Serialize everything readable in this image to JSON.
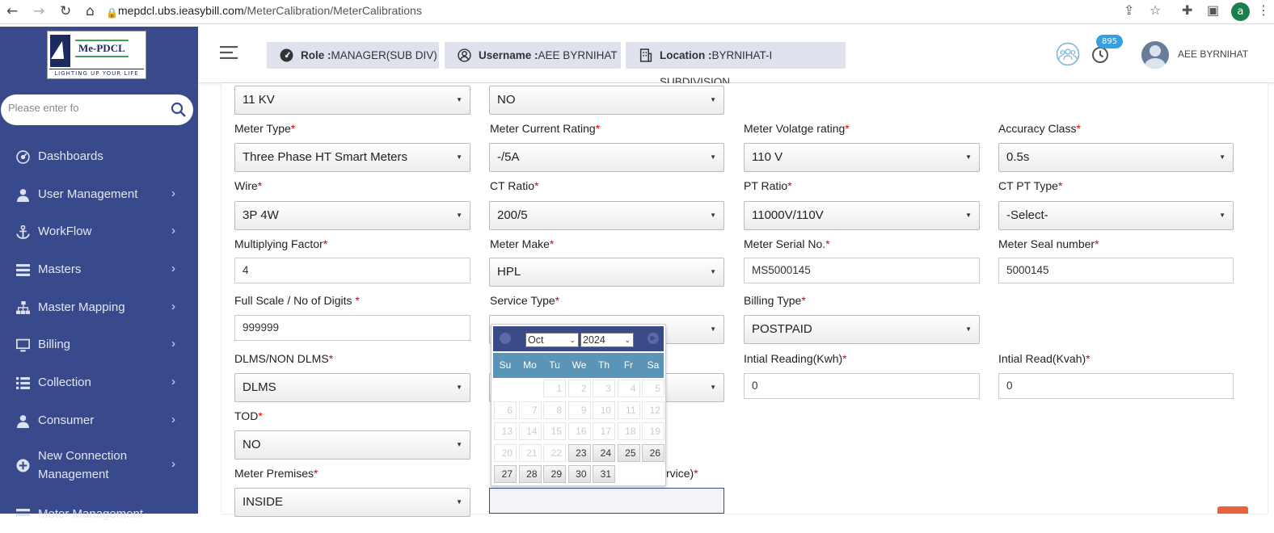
{
  "browser": {
    "url_host": "mepdcl.ubs.ieasybill.com",
    "url_path": "/MeterCalibration/MeterCalibrations",
    "profile_initial": "a"
  },
  "sidebar": {
    "logo_name": "Me-PDCL",
    "logo_tagline": "LIGHTING UP YOUR LIFE",
    "search_placeholder": "Please enter fo",
    "items": [
      {
        "label": "Dashboards",
        "icon": "dashboard-icon",
        "chevron": false
      },
      {
        "label": "User Management",
        "icon": "user-icon",
        "chevron": true
      },
      {
        "label": "WorkFlow",
        "icon": "anchor-icon",
        "chevron": true
      },
      {
        "label": "Masters",
        "icon": "list-icon",
        "chevron": true
      },
      {
        "label": "Master Mapping",
        "icon": "sitemap-icon",
        "chevron": true
      },
      {
        "label": "Billing",
        "icon": "monitor-icon",
        "chevron": true
      },
      {
        "label": "Collection",
        "icon": "list-icon",
        "chevron": true
      },
      {
        "label": "Consumer",
        "icon": "user-icon",
        "chevron": true
      },
      {
        "label_line1": "New Connection",
        "label_line2": "Management",
        "icon": "plus-circle-icon",
        "chevron": true
      },
      {
        "label": "Meter Management",
        "icon": "list-icon",
        "chevron": true
      }
    ]
  },
  "header": {
    "role_label": "Role :",
    "role_value": "MANAGER(SUB DIV)",
    "username_label": "Username :",
    "username_value": "AEE BYRNIHAT",
    "location_label": "Location :",
    "location_value": "BYRNIHAT-I SUBDIVISION",
    "notification_count": "895",
    "user_display": "AEE BYRNIHAT"
  },
  "form": {
    "voltage_value": "11 KV",
    "top_second_value": "NO",
    "meter_type": {
      "label": "Meter Type",
      "value": "Three Phase HT Smart Meters"
    },
    "meter_current_rating": {
      "label": "Meter Current Rating",
      "value": "-/5A"
    },
    "meter_voltage_rating": {
      "label": "Meter Volatge rating",
      "value": "110 V"
    },
    "accuracy_class": {
      "label": "Accuracy Class",
      "value": "0.5s"
    },
    "wire": {
      "label": "Wire",
      "value": "3P 4W"
    },
    "ct_ratio": {
      "label": "CT Ratio",
      "value": "200/5"
    },
    "pt_ratio": {
      "label": "PT Ratio",
      "value": "11000V/110V"
    },
    "ct_pt_type": {
      "label": "CT PT Type",
      "value": "-Select-"
    },
    "multiplying_factor": {
      "label": "Multiplying Factor",
      "value": "4"
    },
    "meter_make": {
      "label": "Meter Make",
      "value": "HPL"
    },
    "meter_serial_no": {
      "label": "Meter Serial No.",
      "value": "MS5000145"
    },
    "meter_seal_number": {
      "label": "Meter Seal number",
      "value": "5000145"
    },
    "full_scale": {
      "label": "Full Scale / No of Digits ",
      "value": "999999"
    },
    "service_type": {
      "label": "Service Type"
    },
    "billing_type": {
      "label": "Billing Type",
      "value": "POSTPAID"
    },
    "dlms": {
      "label": "DLMS/NON DLMS",
      "value": "DLMS"
    },
    "initial_reading_kwh": {
      "label": "Intial Reading(Kwh)",
      "value": "0"
    },
    "initial_read_kvah": {
      "label": "Intial Read(Kvah)",
      "value": "0"
    },
    "tod": {
      "label": "TOD",
      "value": "NO"
    },
    "meter_premises": {
      "label": "Meter Premises",
      "value": "INSIDE"
    },
    "date_partial_label": "rvice)",
    "required_mark": "*"
  },
  "datepicker": {
    "month": "Oct",
    "year": "2024",
    "weekdays": [
      "Su",
      "Mo",
      "Tu",
      "We",
      "Th",
      "Fr",
      "Sa"
    ],
    "disabled_days": [
      "1",
      "2",
      "3",
      "4",
      "5",
      "6",
      "7",
      "8",
      "9",
      "10",
      "11",
      "12",
      "13",
      "14",
      "15",
      "16",
      "17",
      "18",
      "19",
      "20",
      "21",
      "22"
    ],
    "enabled_days": [
      "23",
      "24",
      "25",
      "26",
      "27",
      "28",
      "29",
      "30",
      "31"
    ]
  },
  "colors": {
    "sidebar_bg": "#384a8c",
    "datepicker_header": "#3a4a86",
    "weekday_bar": "#5a95b8",
    "badge": "#35a0e0",
    "required": "#dd0000"
  }
}
